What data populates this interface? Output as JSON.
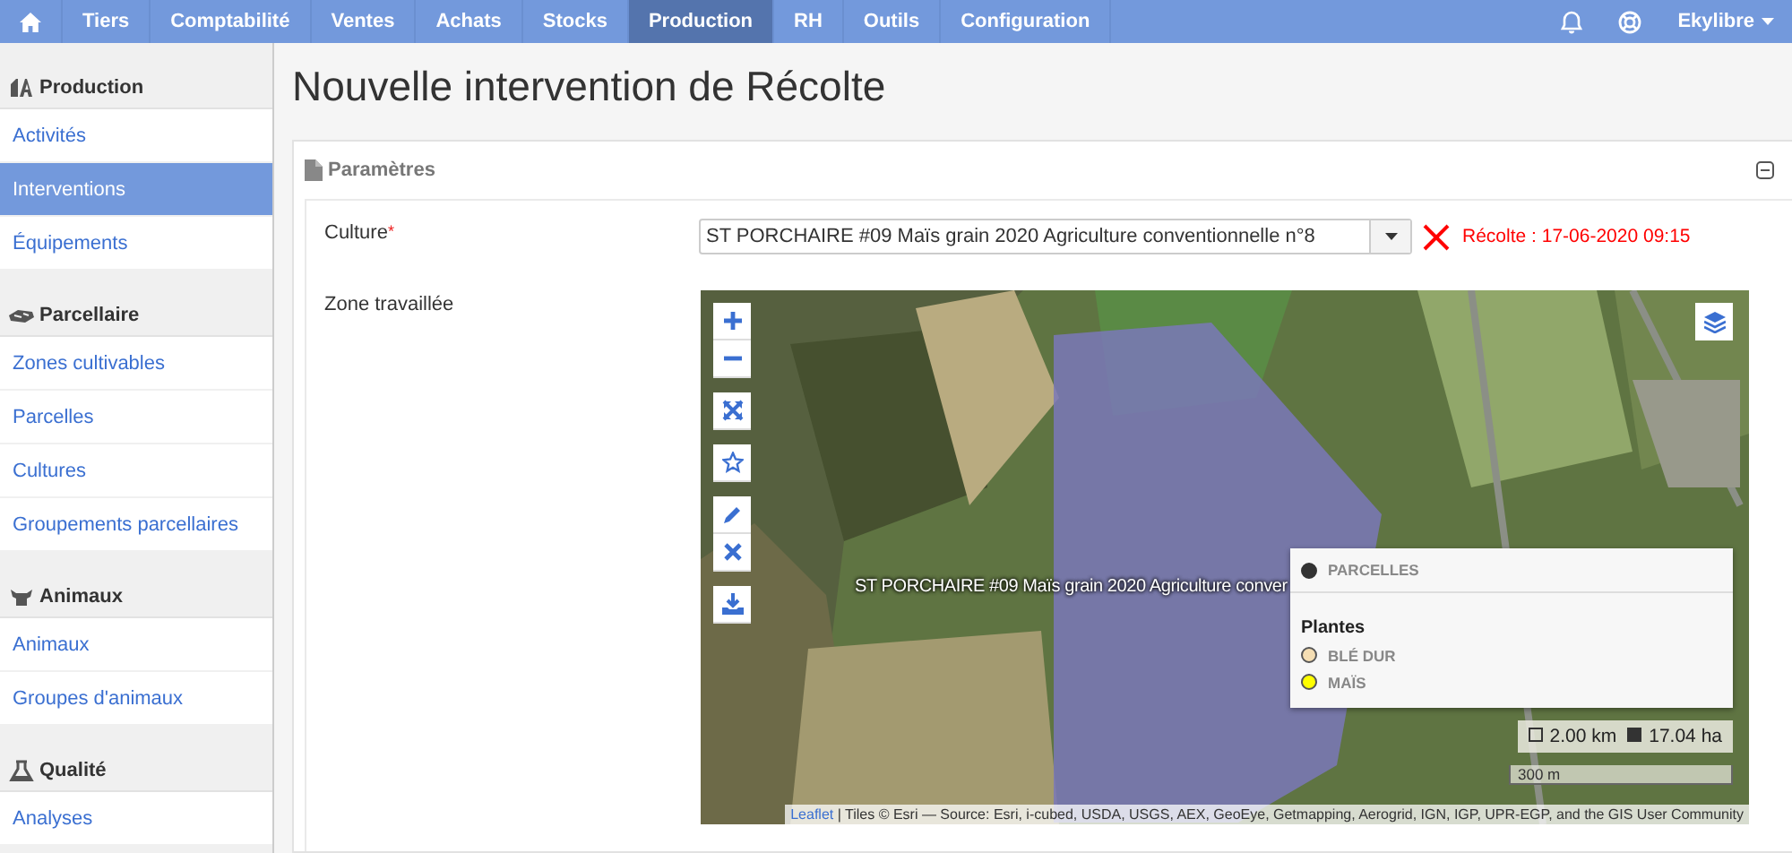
{
  "topbar": {
    "nav": [
      {
        "label": "Tiers",
        "selected": false
      },
      {
        "label": "Comptabilité",
        "selected": false
      },
      {
        "label": "Ventes",
        "selected": false
      },
      {
        "label": "Achats",
        "selected": false
      },
      {
        "label": "Stocks",
        "selected": false
      },
      {
        "label": "Production",
        "selected": true
      },
      {
        "label": "RH",
        "selected": false
      },
      {
        "label": "Outils",
        "selected": false
      },
      {
        "label": "Configuration",
        "selected": false
      }
    ],
    "user": "Ekylibre"
  },
  "sidebar": {
    "sections": [
      {
        "title": "Production",
        "kind": "production",
        "items": [
          {
            "label": "Activités",
            "selected": false
          },
          {
            "label": "Interventions",
            "selected": true
          },
          {
            "label": "Équipements",
            "selected": false
          }
        ]
      },
      {
        "title": "Parcellaire",
        "kind": "land",
        "items": [
          {
            "label": "Zones cultivables",
            "selected": false
          },
          {
            "label": "Parcelles",
            "selected": false
          },
          {
            "label": "Cultures",
            "selected": false
          },
          {
            "label": "Groupements parcellaires",
            "selected": false
          }
        ]
      },
      {
        "title": "Animaux",
        "kind": "animals",
        "items": [
          {
            "label": "Animaux",
            "selected": false
          },
          {
            "label": "Groupes d'animaux",
            "selected": false
          }
        ]
      },
      {
        "title": "Qualité",
        "kind": "quality",
        "items": [
          {
            "label": "Analyses",
            "selected": false
          }
        ]
      }
    ]
  },
  "page": {
    "title": "Nouvelle intervention de Récolte"
  },
  "panel": {
    "title": "Paramètres",
    "culture": {
      "label": "Culture",
      "required_mark": "*",
      "value": "ST PORCHAIRE #09 Maïs grain 2020 Agriculture conventionnelle n°8",
      "error": "Récolte : 17-06-2020 09:15"
    },
    "zone": {
      "label": "Zone travaillée",
      "map": {
        "parcel_label": "ST PORCHAIRE #09 Maïs grain 2020 Agriculture conver",
        "legend": {
          "layer": {
            "label": "PARCELLES",
            "color": "#333333"
          },
          "group": "Plantes",
          "items": [
            {
              "label": "BLÉ DUR",
              "color": "#f5deb3"
            },
            {
              "label": "MAÏS",
              "color": "#ffff00"
            }
          ]
        },
        "measure": {
          "length": "2.00 km",
          "area": "17.04 ha"
        },
        "scale": "300 m",
        "attribution": {
          "link": "Leaflet",
          "text": "| Tiles © Esri — Source: Esri, i-cubed, USDA, USGS, AEX, GeoEye, Getmapping, Aerogrid, IGN, IGP, UPR-EGP, and the GIS User Community"
        }
      }
    }
  }
}
